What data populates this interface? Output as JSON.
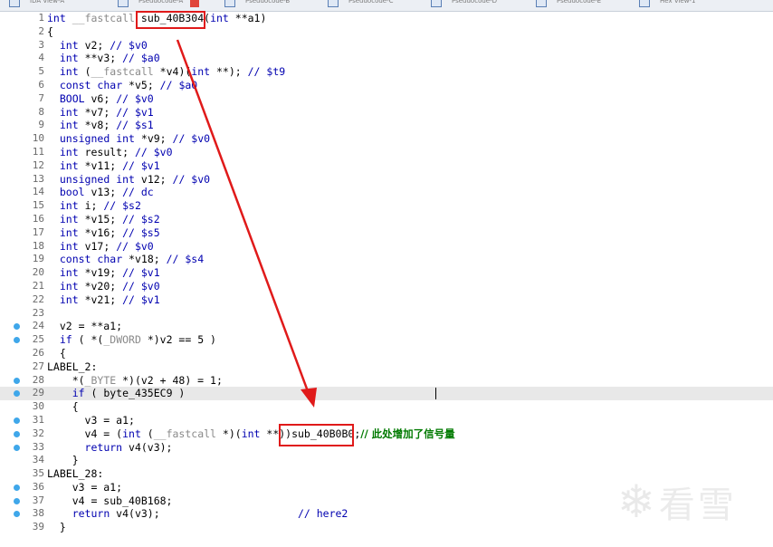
{
  "tabs": [
    {
      "label": "IDA View-A",
      "close": false
    },
    {
      "label": "Pseudocode-A",
      "close": true
    },
    {
      "label": "Pseudocode-B",
      "close": false
    },
    {
      "label": "Pseudocode-C",
      "close": false
    },
    {
      "label": "Pseudocode-D",
      "close": false
    },
    {
      "label": "Pseudocode-E",
      "close": false
    },
    {
      "label": "Hex View-1",
      "close": false
    }
  ],
  "lines": [
    {
      "n": "1",
      "text": "int __fastcall sub_40B304(int **a1)",
      "bp": false
    },
    {
      "n": "2",
      "text": "{",
      "bp": false
    },
    {
      "n": "3",
      "text": "  int v2; // $v0",
      "bp": false
    },
    {
      "n": "4",
      "text": "  int **v3; // $a0",
      "bp": false
    },
    {
      "n": "5",
      "text": "  int (__fastcall *v4)(int **); // $t9",
      "bp": false
    },
    {
      "n": "6",
      "text": "  const char *v5; // $a0",
      "bp": false
    },
    {
      "n": "7",
      "text": "  BOOL v6; // $v0",
      "bp": false
    },
    {
      "n": "8",
      "text": "  int *v7; // $v1",
      "bp": false
    },
    {
      "n": "9",
      "text": "  int *v8; // $s1",
      "bp": false
    },
    {
      "n": "10",
      "text": "  unsigned int *v9; // $v0",
      "bp": false
    },
    {
      "n": "11",
      "text": "  int result; // $v0",
      "bp": false
    },
    {
      "n": "12",
      "text": "  int *v11; // $v1",
      "bp": false
    },
    {
      "n": "13",
      "text": "  unsigned int v12; // $v0",
      "bp": false
    },
    {
      "n": "14",
      "text": "  bool v13; // dc",
      "bp": false
    },
    {
      "n": "15",
      "text": "  int i; // $s2",
      "bp": false
    },
    {
      "n": "16",
      "text": "  int *v15; // $s2",
      "bp": false
    },
    {
      "n": "17",
      "text": "  int *v16; // $s5",
      "bp": false
    },
    {
      "n": "18",
      "text": "  int v17; // $v0",
      "bp": false
    },
    {
      "n": "19",
      "text": "  const char *v18; // $s4",
      "bp": false
    },
    {
      "n": "20",
      "text": "  int *v19; // $v1",
      "bp": false
    },
    {
      "n": "21",
      "text": "  int *v20; // $v0",
      "bp": false
    },
    {
      "n": "22",
      "text": "  int *v21; // $v1",
      "bp": false
    },
    {
      "n": "23",
      "text": "",
      "bp": false
    },
    {
      "n": "24",
      "text": "  v2 = **a1;",
      "bp": true
    },
    {
      "n": "25",
      "text": "  if ( *(_DWORD *)v2 == 5 )",
      "bp": true
    },
    {
      "n": "26",
      "text": "  {",
      "bp": false
    },
    {
      "n": "27",
      "text": "LABEL_2:",
      "bp": false
    },
    {
      "n": "28",
      "text": "    *(_BYTE *)(v2 + 48) = 1;",
      "bp": true
    },
    {
      "n": "29",
      "text": "    if ( byte_435EC9 )",
      "bp": true
    },
    {
      "n": "30",
      "text": "    {",
      "bp": false
    },
    {
      "n": "31",
      "text": "      v3 = a1;",
      "bp": true
    },
    {
      "n": "32",
      "text": "      v4 = (int (__fastcall *)(int **))sub_40B0B0;// 此处增加了信号量",
      "bp": true
    },
    {
      "n": "33",
      "text": "      return v4(v3);",
      "bp": true
    },
    {
      "n": "34",
      "text": "    }",
      "bp": false
    },
    {
      "n": "35",
      "text": "LABEL_28:",
      "bp": false
    },
    {
      "n": "36",
      "text": "    v3 = a1;",
      "bp": true
    },
    {
      "n": "37",
      "text": "    v4 = sub_40B168;",
      "bp": true
    },
    {
      "n": "38",
      "text": "    return v4(v3);                      // here2",
      "bp": true
    },
    {
      "n": "39",
      "text": "  }",
      "bp": false
    }
  ],
  "highlighted_line": "29",
  "watermark": {
    "text": "看雪"
  },
  "colors": {
    "keyword": "#0000b0",
    "comment_green": "#007a00",
    "annotation_red": "#e01a1a",
    "breakpoint": "#3fa7ea"
  }
}
